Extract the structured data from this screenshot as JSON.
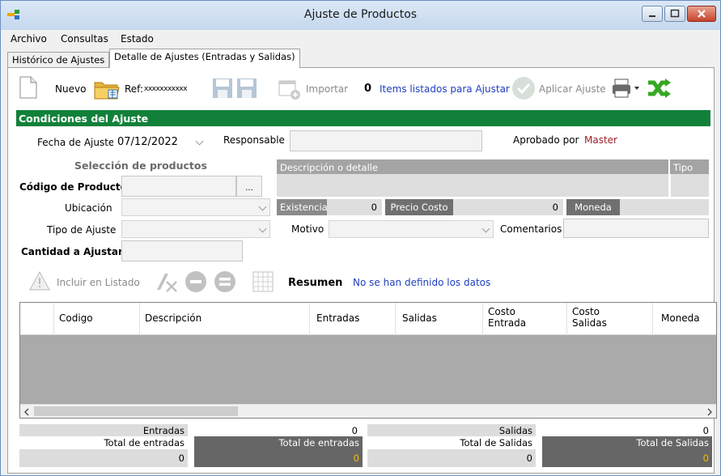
{
  "window": {
    "title": "Ajuste de Productos"
  },
  "menu": [
    "Archivo",
    "Consultas",
    "Estado"
  ],
  "tabs": [
    "Histórico de Ajustes",
    "Detalle de Ajustes (Entradas y Salidas)"
  ],
  "toolbar": {
    "nuevo": "Nuevo",
    "ref_label": "Ref:",
    "ref_value": "xxxxxxxxxxx",
    "importar": "Importar",
    "count": "0",
    "count_label": "Items listados para Ajustar",
    "aplicar": "Aplicar Ajuste"
  },
  "section": {
    "title": "Condiciones del Ajuste",
    "fecha_label": "Fecha de Ajuste",
    "fecha_value": "07/12/2022",
    "responsable_label": "Responsable",
    "aprobado_label": "Aprobado por",
    "aprobado_value": "Master"
  },
  "seleccion": {
    "title": "Selección de productos",
    "codigo_label": "Código de Producto",
    "ubicacion_label": "Ubicación",
    "tipo_label": "Tipo de Ajuste",
    "cantidad_label": "Cantidad a Ajustar",
    "browse_label": "...",
    "descripcion_header": "Descripción o detalle",
    "tipo_header": "Tipo",
    "existencia_label": "Existencia",
    "existencia_value": "0",
    "precio_label": "Precio Costo",
    "precio_value": "0",
    "moneda_label": "Moneda",
    "motivo_label": "Motivo",
    "comentarios_label": "Comentarios"
  },
  "list_toolbar": {
    "incluir": "Incluir en Listado",
    "resumen_label": "Resumen",
    "resumen_text": "No se han definido los datos"
  },
  "grid": {
    "columns": [
      "Codigo",
      "Descripción",
      "Entradas",
      "Salidas",
      "Costo Entrada",
      "Costo Salidas",
      "Moneda"
    ],
    "rows": []
  },
  "summary": {
    "entradas_label": "Entradas",
    "entradas_value": "0",
    "salidas_label": "Salidas",
    "salidas_value": "0",
    "total_entradas_label": "Total de entradas",
    "total_entradas_value": "0",
    "total_entradas_dark_label": "Total de entradas",
    "total_entradas_dark_value": "0",
    "total_salidas_label": "Total de Salidas",
    "total_salidas_value": "0",
    "total_salidas_dark_label": "Total de Salidas",
    "total_salidas_dark_value": "0"
  },
  "colors": {
    "accent_green": "#11813a",
    "link_blue": "#1f3fbf",
    "master_red": "#a01f2a",
    "total_yellow": "#f2c200"
  }
}
